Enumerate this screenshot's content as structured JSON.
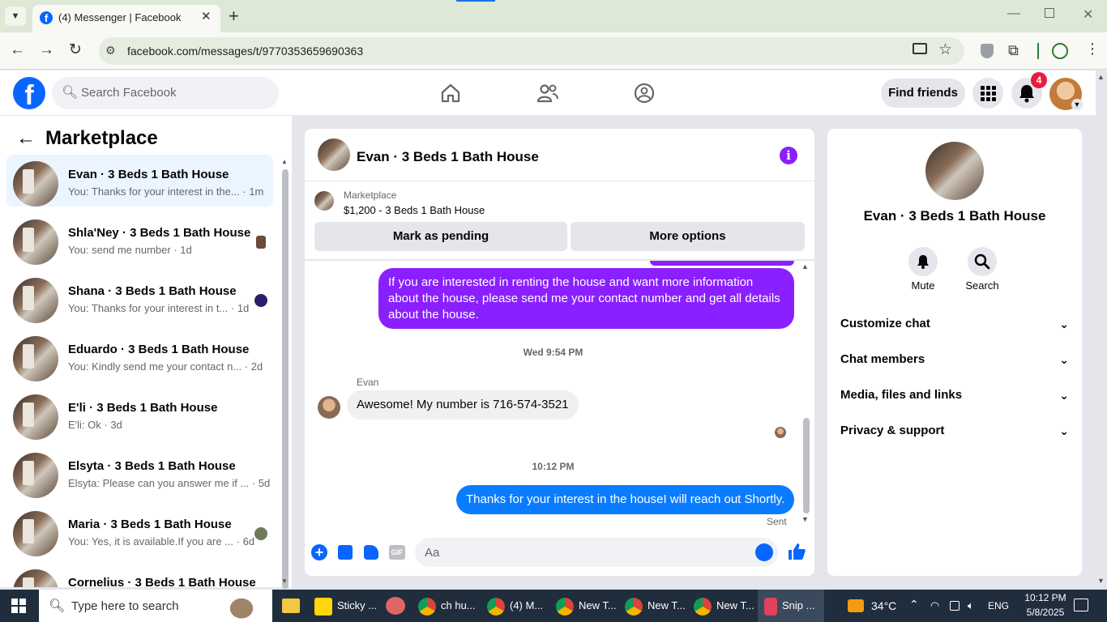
{
  "browser": {
    "tab_title": "(4) Messenger | Facebook",
    "url": "facebook.com/messages/t/9770353659690363"
  },
  "fb": {
    "search_placeholder": "Search Facebook",
    "find_friends": "Find friends",
    "notif_count": "4"
  },
  "sidebar": {
    "title": "Marketplace",
    "conversations": [
      {
        "name": "Evan · 3 Beds 1 Bath House",
        "preview": "You: Thanks for your interest in the... · 1m"
      },
      {
        "name": "Shla'Ney · 3 Beds 1 Bath House",
        "preview": "You: send me number · 1d"
      },
      {
        "name": "Shana · 3 Beds 1 Bath House",
        "preview": "You: Thanks for your interest in t... · 1d"
      },
      {
        "name": "Eduardo · 3 Beds 1 Bath House",
        "preview": "You: Kindly send me your contact n... · 2d"
      },
      {
        "name": "E'li · 3 Beds 1 Bath House",
        "preview": "E'li: Ok · 3d"
      },
      {
        "name": "Elsyta · 3 Beds 1 Bath House",
        "preview": "Elsyta: Please can you answer me if ... · 5d"
      },
      {
        "name": "Maria · 3 Beds 1 Bath House",
        "preview": "You: Yes, it is available.If you are ... · 6d"
      },
      {
        "name": "Cornelius · 3 Beds 1 Bath House",
        "preview": ""
      }
    ]
  },
  "chat": {
    "header_title": "Evan · 3 Beds 1 Bath House",
    "listing_source": "Marketplace",
    "listing_title": "$1,200 - 3 Beds 1 Bath House",
    "mark_pending": "Mark as pending",
    "more_options": "More options",
    "msg_out_1": "If you are interested in renting the house and want more information about the house, please send me your contact number and get all details about the house.",
    "time_1": "Wed 9:54 PM",
    "sender_name": "Evan",
    "msg_in_1": "Awesome! My number is 716-574-3521",
    "time_2": "10:12 PM",
    "msg_out_2": "Thanks for your interest in the houseI will reach out Shortly.",
    "sent_status": "Sent",
    "composer_placeholder": "Aa"
  },
  "info": {
    "name": "Evan · 3 Beds 1 Bath House",
    "mute": "Mute",
    "search": "Search",
    "sections": [
      "Customize chat",
      "Chat members",
      "Media, files and links",
      "Privacy & support"
    ]
  },
  "taskbar": {
    "search_placeholder": "Type here to search",
    "apps": [
      "Sticky ...",
      "ch hu...",
      "(4) M...",
      "New T...",
      "New T...",
      "New T...",
      "Snip ..."
    ],
    "temperature": "34°C",
    "language": "ENG",
    "time": "10:12 PM",
    "date": "5/8/2025"
  },
  "colors": {
    "messenger_purple": "#8a1fff",
    "messenger_blue": "#0a7cff",
    "fb_blue": "#0866ff"
  }
}
